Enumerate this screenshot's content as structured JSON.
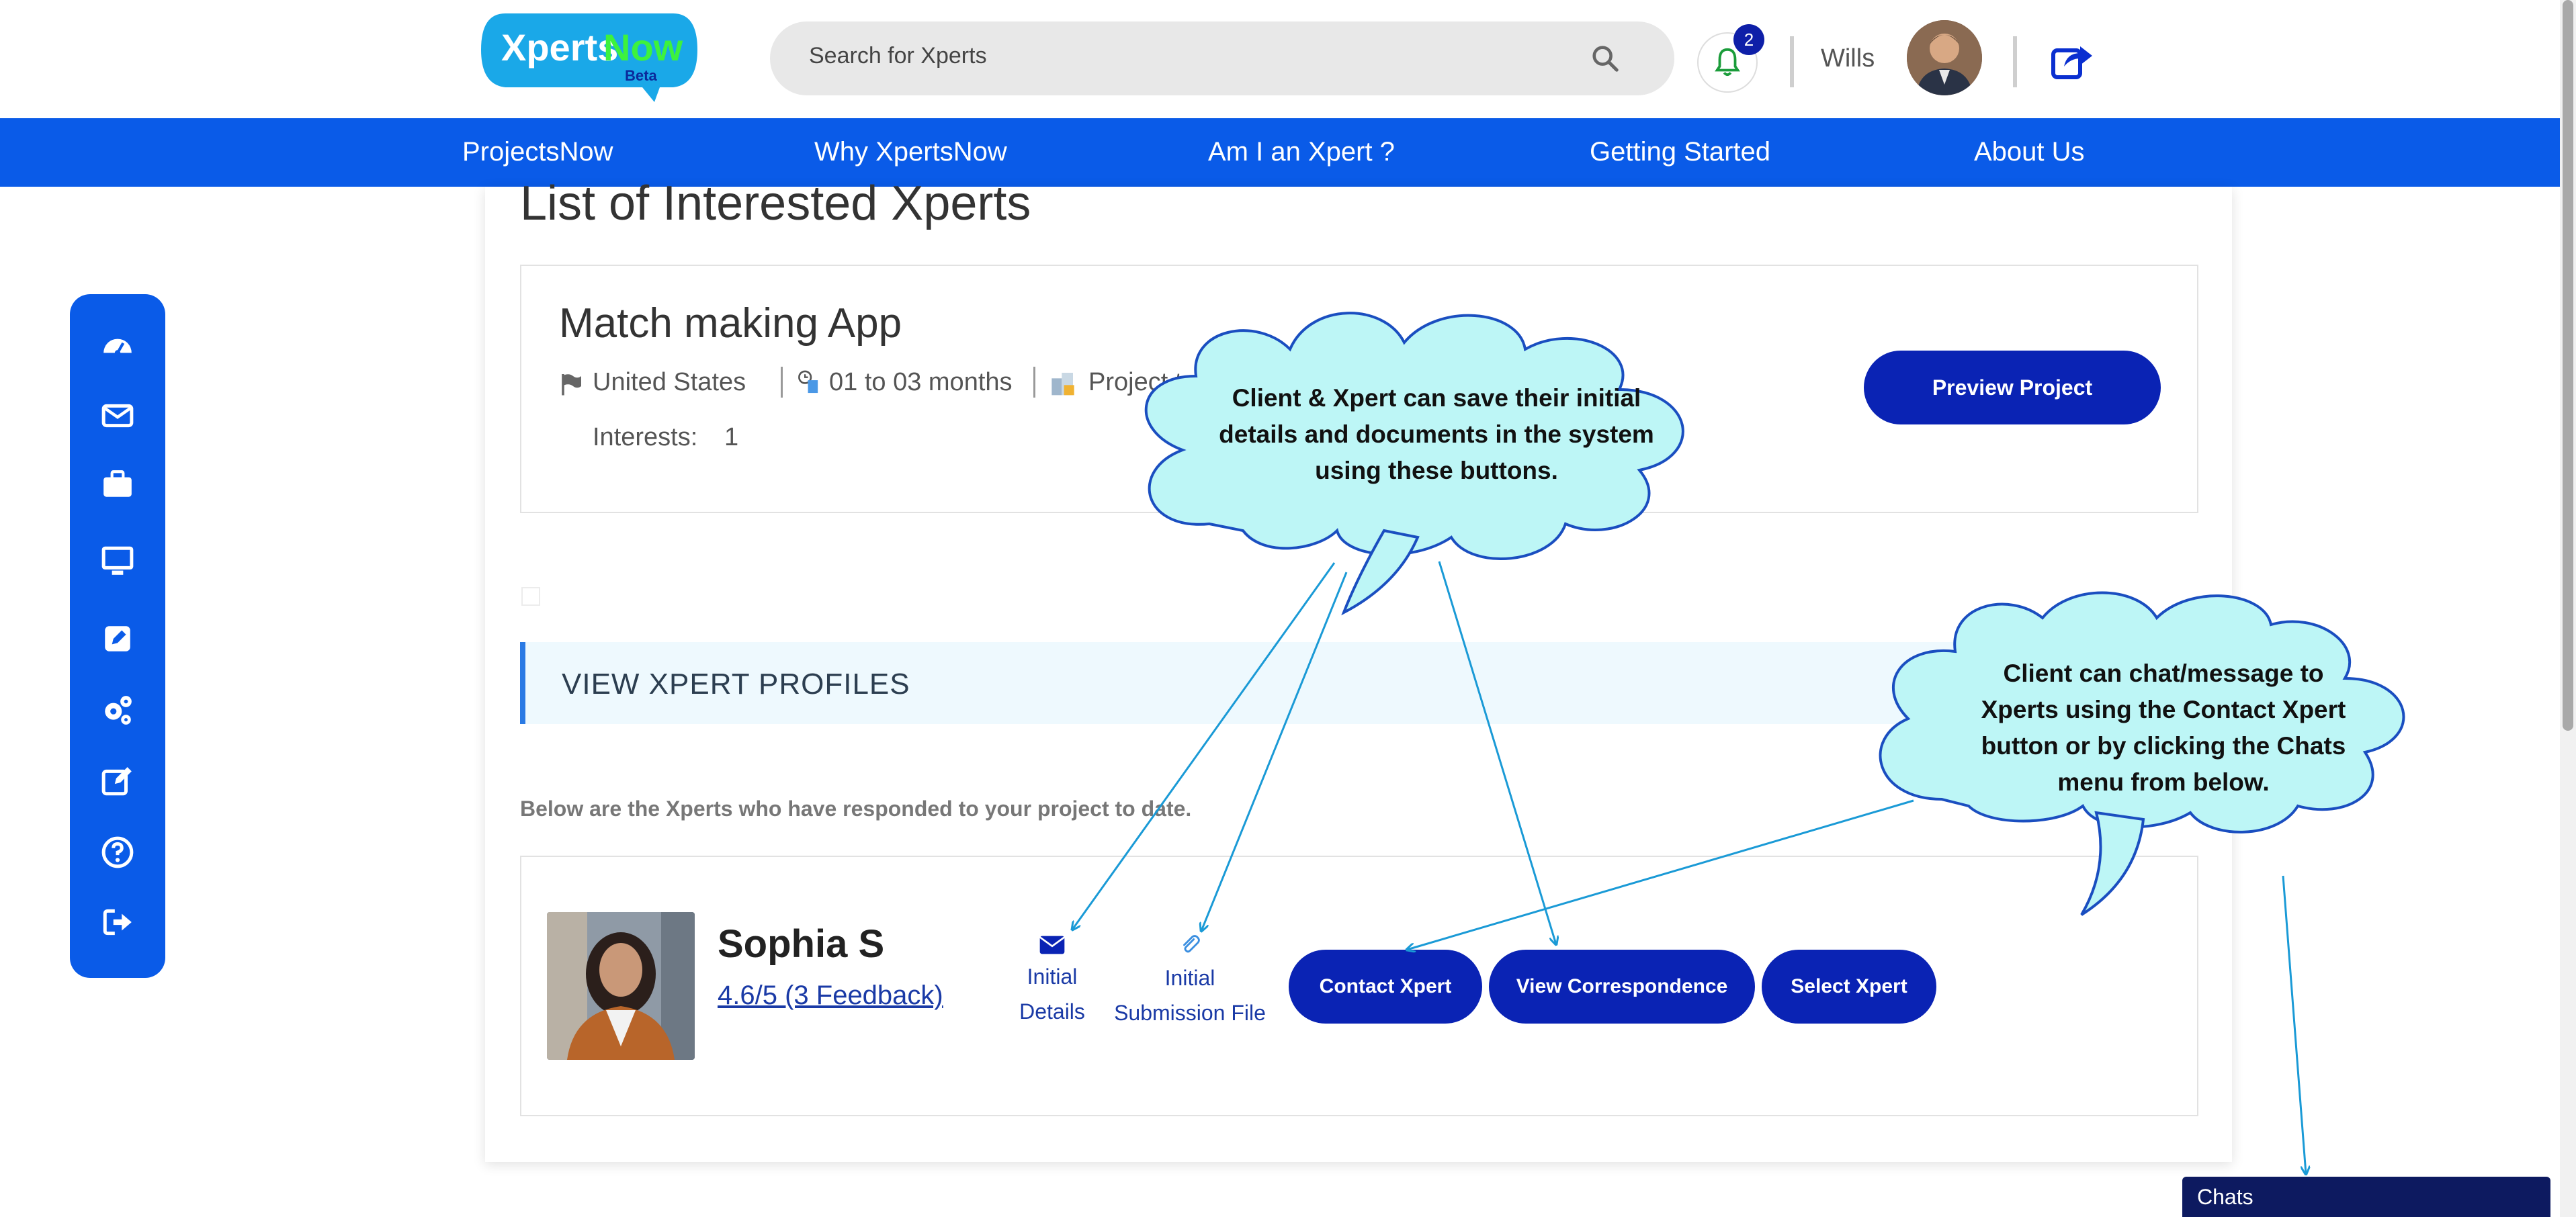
{
  "header": {
    "logo": {
      "word1": "Xperts",
      "word2": "Now",
      "badge": "Beta"
    },
    "search_placeholder": "Search for Xperts",
    "notification_count": "2",
    "user_name": "Wills"
  },
  "nav": {
    "items": [
      "ProjectsNow",
      "Why XpertsNow",
      "Am I an Xpert ?",
      "Getting Started",
      "About Us"
    ]
  },
  "page": {
    "title": "List of Interested Xperts"
  },
  "project": {
    "name": "Match making App",
    "country": "United States",
    "duration": "01 to 03 months",
    "type_label": "Project ty",
    "interests_label": "Interests:",
    "interests_value": "1",
    "preview_button": "Preview Project"
  },
  "profiles": {
    "section_title": "VIEW XPERT PROFILES",
    "note": "Below are the Xperts who have responded to your project to date.",
    "xpert": {
      "name": "Sophia S",
      "rating": "4.6/5 (3  Feedback)",
      "initial_details_1": "Initial",
      "initial_details_2": "Details",
      "initial_file_1": "Initial",
      "initial_file_2": "Submission File",
      "contact_button": "Contact Xpert",
      "correspondence_button": "View Correspondence",
      "select_button": "Select Xpert"
    }
  },
  "annotations": {
    "cloud1": "Client & Xpert can save their initial details and documents in the system using these buttons.",
    "cloud2": "Client can chat/message to Xperts using the Contact Xpert button or by clicking the Chats menu from below."
  },
  "chats": {
    "label": "Chats"
  },
  "colors": {
    "primary_blue": "#0a5be8",
    "button_navy": "#0a23b4",
    "cloud_fill": "#bdf6f6",
    "arrow": "#1a9ad6"
  },
  "icons": {
    "sidebar": [
      "dashboard-icon",
      "envelope-icon",
      "briefcase-icon",
      "monitor-icon",
      "edit-box-icon",
      "gears-icon",
      "pencil-square-icon",
      "question-icon",
      "sign-out-icon"
    ]
  }
}
